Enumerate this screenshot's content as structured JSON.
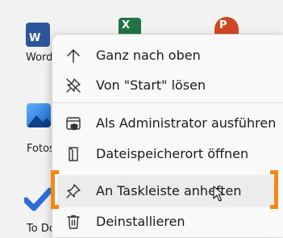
{
  "apps": [
    {
      "label": "Word",
      "icon": "word-icon",
      "letter": "W",
      "color": "#2b579a"
    },
    {
      "label": "",
      "icon": "excel-icon",
      "letter": "X",
      "color": "#217346"
    },
    {
      "label": "",
      "icon": "powerpoint-icon",
      "letter": "P",
      "color": "#d24726"
    },
    {
      "label": "Fotos",
      "icon": "photos-icon",
      "color": "#2a7fd4"
    },
    {
      "label": "To Do",
      "icon": "todo-icon",
      "color": "#2b6fd6"
    }
  ],
  "context_menu": {
    "items": [
      {
        "label": "Ganz nach oben",
        "icon": "arrow-up-icon"
      },
      {
        "label": "Von \"Start\" lösen",
        "icon": "unpin-icon"
      },
      {
        "label": "Als Administrator ausführen",
        "icon": "shield-window-icon"
      },
      {
        "label": "Dateispeicherort öffnen",
        "icon": "folder-location-icon"
      },
      {
        "label": "An Taskleiste anheften",
        "icon": "pin-icon",
        "highlighted": true
      },
      {
        "label": "Deinstallieren",
        "icon": "trash-icon"
      }
    ]
  },
  "colors": {
    "highlight_bracket": "#ef8a17",
    "menu_bg": "#f9f9f9"
  }
}
